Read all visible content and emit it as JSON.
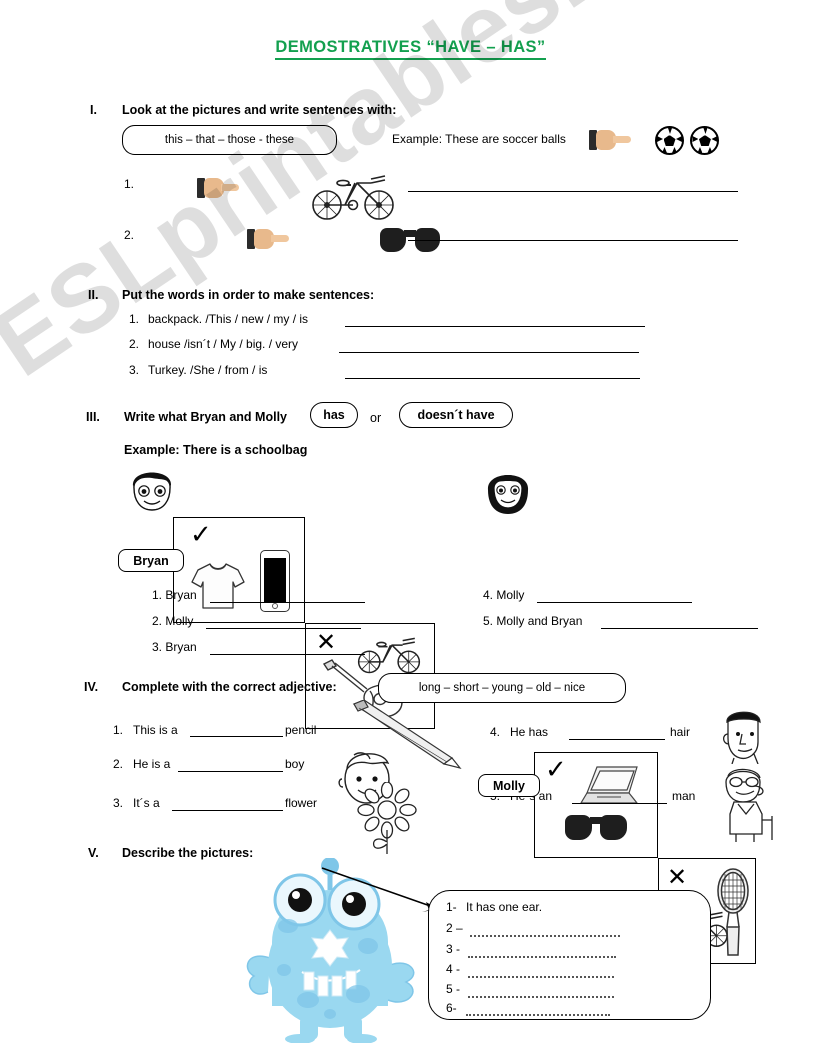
{
  "title": "DEMOSTRATIVES   “HAVE – HAS”",
  "watermark": "ESLprintables.com",
  "section1": {
    "number": "I.",
    "heading": "Look at the pictures and write sentences with:",
    "wordbank": "this – that – those - these",
    "example": "Example: These are soccer balls",
    "items": [
      {
        "number": "1.",
        "icons": [
          "pointing-hand-icon",
          "bicycle-icon"
        ]
      },
      {
        "number": "2.",
        "icons": [
          "pointing-hand-icon",
          "sunglasses-icon"
        ]
      }
    ]
  },
  "section2": {
    "number": "II.",
    "heading": "Put the words in order to make sentences:",
    "items": [
      {
        "number": "1.",
        "text": "backpack. /This / new / my / is"
      },
      {
        "number": "2.",
        "text": "house /isn´t  / My / big. / very"
      },
      {
        "number": "3.",
        "text": "Turkey. /She / from / is"
      }
    ]
  },
  "section3": {
    "number": "III.",
    "heading_before": "Write what Bryan and Molly",
    "chip_has": "has",
    "chip_or": "or",
    "chip_doesnt": "doesn´t have",
    "example": "Example: There is a schoolbag",
    "people": [
      {
        "name": "Bryan",
        "avatar": "boy-avatar-icon",
        "has_mark": "✓",
        "has_items": [
          "tshirt-icon",
          "phone-icon"
        ],
        "not_mark": "✕",
        "not_items": [
          "bicycle-icon",
          "guitar-icon"
        ]
      },
      {
        "name": "Molly",
        "avatar": "girl-avatar-icon",
        "has_mark": "✓",
        "has_items": [
          "laptop-icon",
          "sunglasses-icon"
        ],
        "not_mark": "✕",
        "not_items": [
          "bicycle-icon",
          "tennis-racket-icon"
        ]
      }
    ],
    "answers_left": [
      {
        "number": "1.",
        "text": "Bryan"
      },
      {
        "number": "2.",
        "text": "Molly"
      },
      {
        "number": "3.",
        "text": "Bryan"
      }
    ],
    "answers_right": [
      {
        "number": "4.",
        "text": "Molly"
      },
      {
        "number": "5.",
        "text": "Molly  and Bryan"
      }
    ]
  },
  "section4": {
    "number": "IV.",
    "heading": "Complete with the correct adjective:",
    "wordbank": "long  – short – young – old – nice",
    "items_left": [
      {
        "number": "1.",
        "before": "This is a",
        "after": "pencil"
      },
      {
        "number": "2.",
        "before": "He is a",
        "after": "boy"
      },
      {
        "number": "3.",
        "before": "It´s a",
        "after": "flower"
      }
    ],
    "items_right": [
      {
        "number": "4.",
        "before": "He  has",
        "after": "hair"
      },
      {
        "number": "5.",
        "before": "He´s  an",
        "after": "man"
      }
    ],
    "illustrations": [
      "pencil-icon",
      "boy-face-icon",
      "flower-icon",
      "man-face-icon",
      "old-man-icon"
    ]
  },
  "section5": {
    "number": "V.",
    "heading": "Describe the pictures:",
    "picture": "blue-monster-icon",
    "answer_lines": [
      {
        "number": "1-",
        "text": "It  has one ear."
      },
      {
        "number": "2 –",
        "text": ""
      },
      {
        "number": "3 -",
        "text": ""
      },
      {
        "number": "4 -",
        "text": ""
      },
      {
        "number": "5 -",
        "text": ""
      },
      {
        "number": "6-",
        "text": ""
      }
    ]
  }
}
